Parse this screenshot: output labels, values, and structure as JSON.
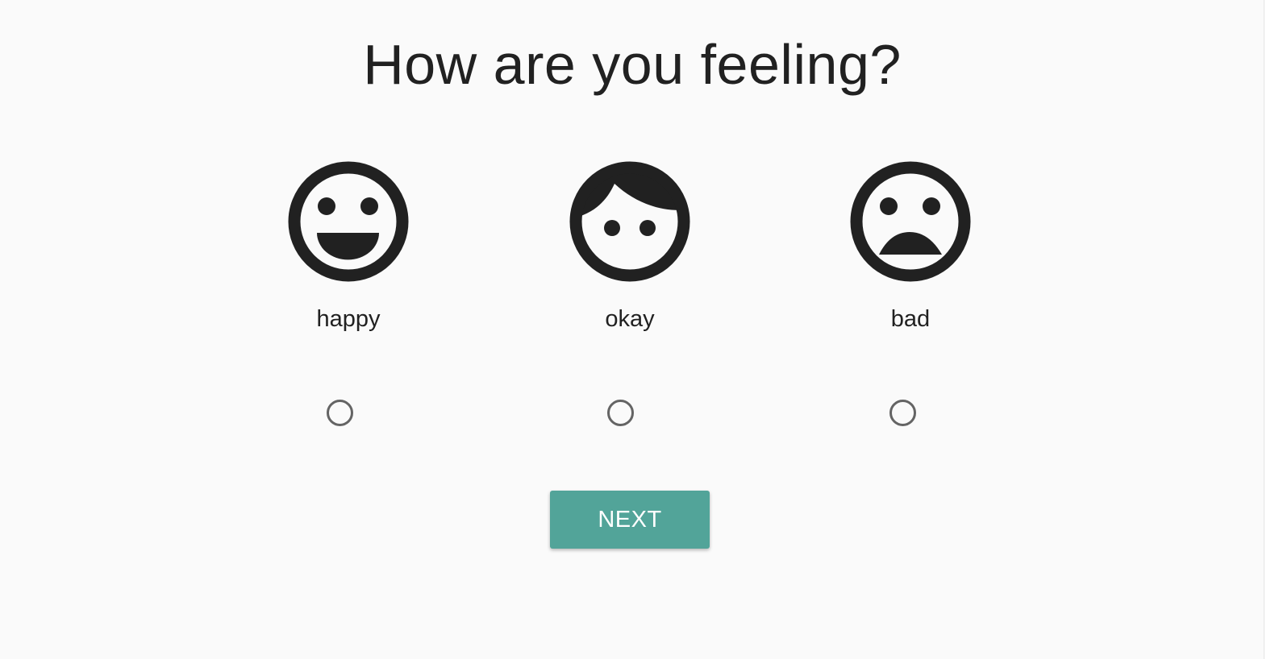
{
  "page": {
    "title": "How are you feeling?"
  },
  "options": [
    {
      "label": "happy",
      "icon": "happy-face-icon",
      "selected": false
    },
    {
      "label": "okay",
      "icon": "neutral-face-icon",
      "selected": false
    },
    {
      "label": "bad",
      "icon": "sad-face-icon",
      "selected": false
    }
  ],
  "actions": {
    "next_label": "NEXT"
  },
  "colors": {
    "background": "#fafafa",
    "text": "#212121",
    "radio_border": "#646464",
    "button": "#52a499",
    "button_text": "#ffffff"
  }
}
